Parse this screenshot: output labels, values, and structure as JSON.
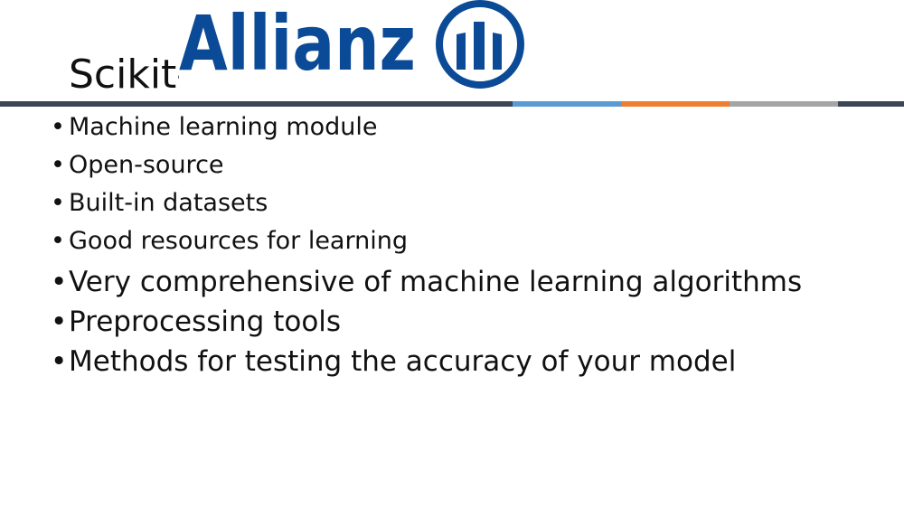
{
  "slide": {
    "title": "Scikit-learn",
    "logo": {
      "wordmark": "Allianz",
      "brand_color": "#0b4a96"
    },
    "divider_colors": [
      "#3d4657",
      "#5b9bd5",
      "#ed7d31",
      "#a5a5a5",
      "#3d4657"
    ],
    "bullet_symbol": "•",
    "bullets": [
      "Machine learning module",
      "Open-source",
      "Built-in datasets",
      "Good resources for learning",
      "Very comprehensive of machine learning algorithms",
      "Preprocessing tools",
      "Methods for testing the accuracy of your model"
    ]
  }
}
